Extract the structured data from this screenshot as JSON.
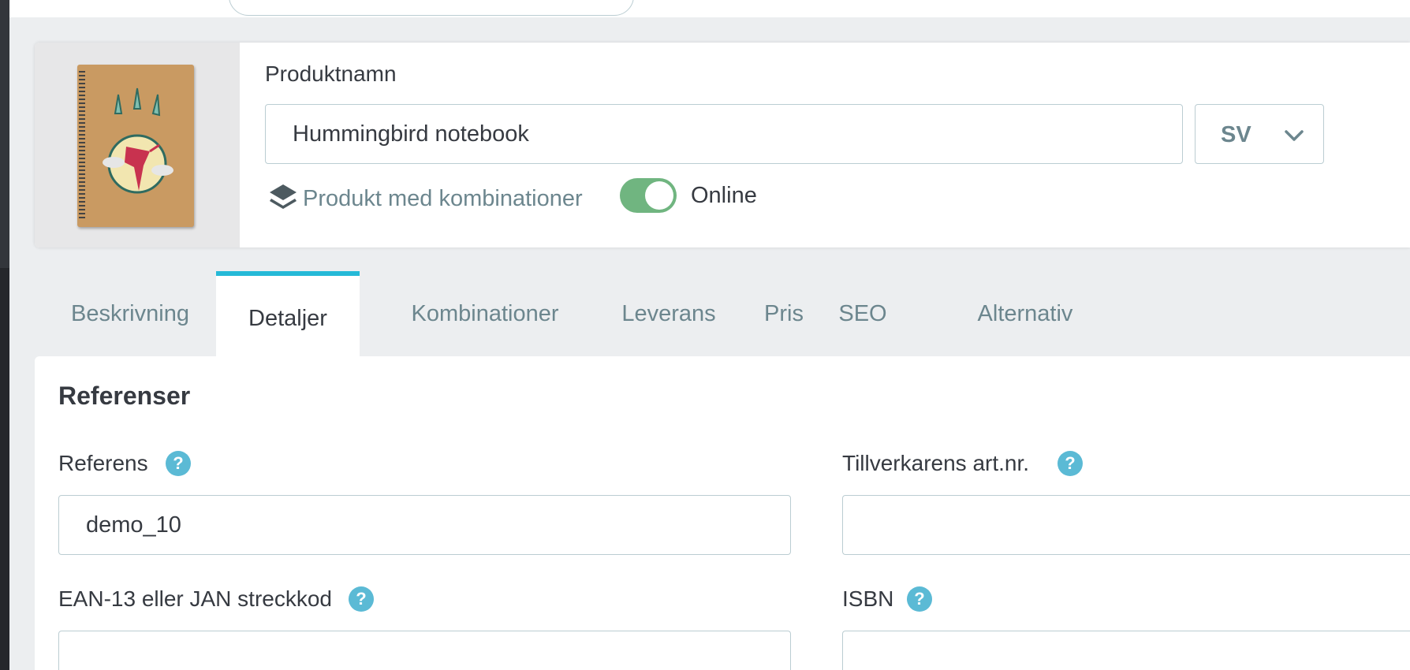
{
  "header": {
    "product_name_label": "Produktnamn",
    "product_name_value": "Hummingbird notebook",
    "language": "SV",
    "combinations_link": "Produkt med kombinationer",
    "status_label": "Online",
    "status_online": true
  },
  "tabs": [
    {
      "label": "Beskrivning"
    },
    {
      "label": "Detaljer",
      "active": true
    },
    {
      "label": "Kombinationer"
    },
    {
      "label": "Leverans"
    },
    {
      "label": "Pris"
    },
    {
      "label": "SEO"
    },
    {
      "label": "Alternativ"
    }
  ],
  "references": {
    "title": "Referenser",
    "reference_label": "Referens",
    "reference_value": "demo_10",
    "mpn_label": "Tillverkarens art.nr.",
    "mpn_value": "",
    "ean_label": "EAN-13 eller JAN streckkod",
    "ean_value": "",
    "isbn_label": "ISBN",
    "isbn_value": "",
    "help_symbol": "?"
  },
  "colors": {
    "accent": "#25b9d7",
    "toggle_on": "#70b580",
    "help_icon": "#5bbad5",
    "muted_text": "#6c868e"
  }
}
